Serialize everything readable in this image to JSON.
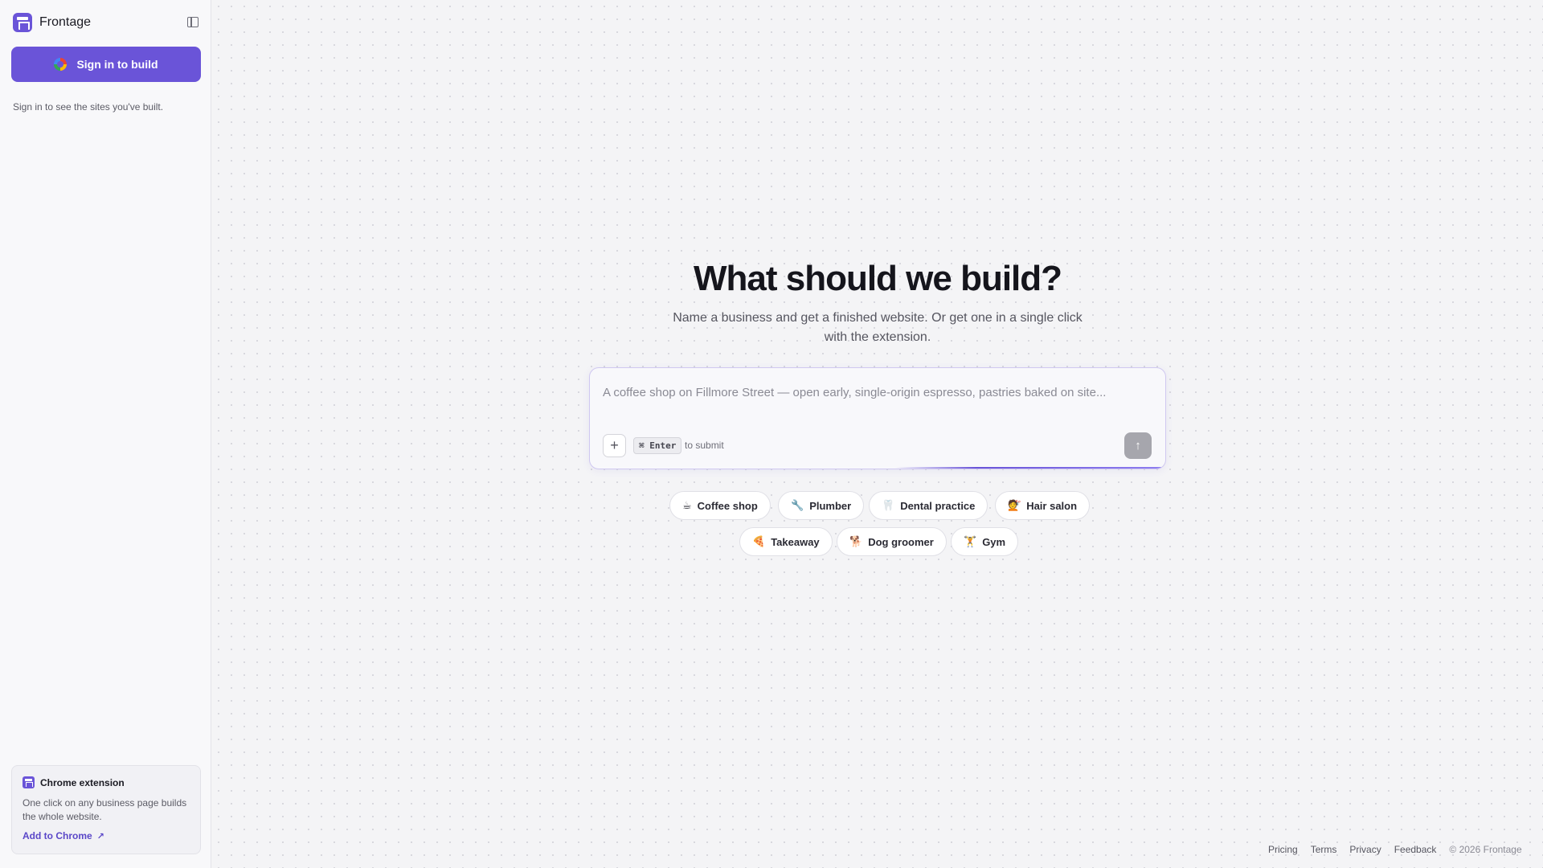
{
  "sidebar": {
    "brand": "Frontage",
    "signin_button": "Sign in to build",
    "signin_hint": "Sign in to see the sites you've built.",
    "extension": {
      "title": "Chrome extension",
      "description": "One click on any business page builds the whole website.",
      "link": "Add to Chrome",
      "link_icon": "↗"
    }
  },
  "main": {
    "headline": "What should we build?",
    "subline": "Name a business and get a finished website. Or get one in a single click with the extension.",
    "prompt": {
      "placeholder": "A coffee shop on Fillmore Street — open early, single-origin espresso, pastries baked on site...",
      "value": "",
      "plus_icon": "+",
      "shortcut": "⌘ Enter",
      "shortcut_hint": "to submit",
      "send_icon": "↑"
    },
    "chips": [
      {
        "emoji": "☕",
        "label": "Coffee shop"
      },
      {
        "emoji": "🔧",
        "label": "Plumber"
      },
      {
        "emoji": "🦷",
        "label": "Dental practice"
      },
      {
        "emoji": "💇",
        "label": "Hair salon"
      },
      {
        "emoji": "🍕",
        "label": "Takeaway"
      },
      {
        "emoji": "🐕",
        "label": "Dog groomer"
      },
      {
        "emoji": "🏋",
        "label": "Gym"
      }
    ]
  },
  "footer": {
    "links": [
      "Pricing",
      "Terms",
      "Privacy",
      "Feedback"
    ],
    "copyright": "© 2026 Frontage"
  },
  "colors": {
    "accent": "#6a54d8",
    "sidebar_bg": "#f8f8fa",
    "main_bg": "#f4f4f6"
  }
}
